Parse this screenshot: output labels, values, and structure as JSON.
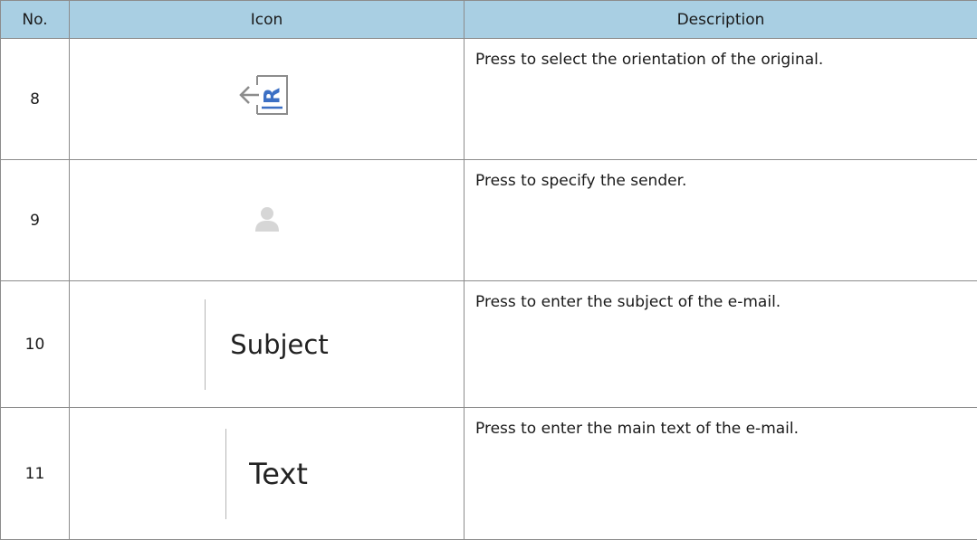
{
  "table": {
    "headers": {
      "no": "No.",
      "icon": "Icon",
      "description": "Description"
    },
    "header_color": "#a9cfe3",
    "rows": [
      {
        "no": "8",
        "icon": "orientation-icon",
        "description": "Press to select the orientation of the original."
      },
      {
        "no": "9",
        "icon": "person-icon",
        "description": "Press to specify the sender."
      },
      {
        "no": "10",
        "icon_text": "Subject",
        "description": "Press to enter the subject of the e-mail."
      },
      {
        "no": "11",
        "icon_text": "Text",
        "description": "Press to enter the main text of the e-mail."
      }
    ]
  },
  "colors": {
    "orientation_icon_blue": "#3b6fc4",
    "icon_gray": "#8c8c8c",
    "person_icon_gray": "#d6d6d6"
  }
}
